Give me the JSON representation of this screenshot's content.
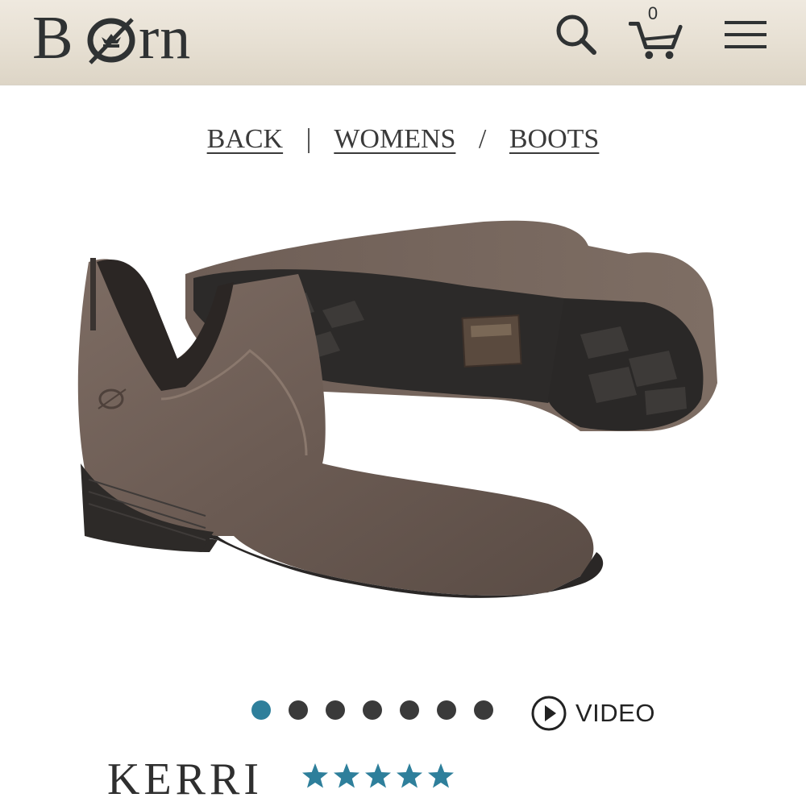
{
  "header": {
    "logo_text": "Børn",
    "cart_count": "0",
    "icons": {
      "search": "search-icon",
      "cart": "cart-icon",
      "menu": "hamburger-menu-icon"
    }
  },
  "breadcrumb": {
    "back_label": "BACK",
    "divider": "|",
    "category_label": "WOMENS",
    "slash": "/",
    "subcategory_label": "BOOTS"
  },
  "carousel": {
    "total_slides": 7,
    "active_index": 0,
    "video_label": "VIDEO"
  },
  "product": {
    "name": "KERRI",
    "rating": 5,
    "rating_max": 5
  },
  "colors": {
    "accent": "#2e7f9b",
    "header_bg": "#e6dfd2",
    "text": "#333333"
  }
}
